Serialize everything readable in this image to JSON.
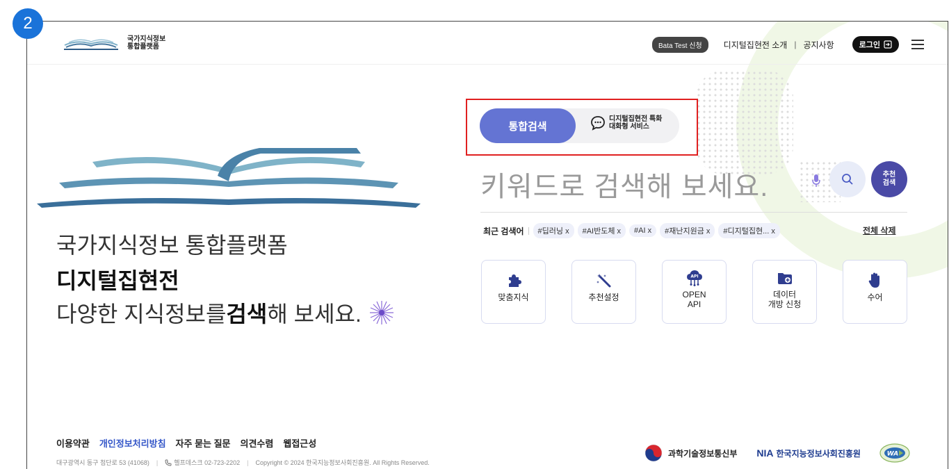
{
  "step_badge": "2",
  "header": {
    "logo_line1": "국가지식정보",
    "logo_line2": "통합플랫폼",
    "beta_button": "Bata Test 신청",
    "links": [
      "디지털집현전 소개",
      "공지사항"
    ],
    "separator": "|",
    "login_button": "로그인",
    "icons": [
      "logo-icon",
      "login-icon",
      "menu-icon"
    ]
  },
  "hero": {
    "line1": "국가지식정보 통합플랫폼",
    "line2": "디지털집현전",
    "line3_pre": "다양한 지식정보를 ",
    "line3_bold": "검색",
    "line3_post": "해 보세요."
  },
  "search": {
    "tab_active": "통합검색",
    "tab_chat_line1": "디지털집현전 특화",
    "tab_chat_line2": "대화형 서비스",
    "placeholder": "키워드로 검색해 보세요.",
    "recommend_line1": "추천",
    "recommend_line2": "검색",
    "recent_label": "최근 검색어",
    "recent_keywords": [
      "#딥러닝 x",
      "#AI반도체 x",
      "#AI x",
      "#재난지원금 x",
      "#디지털집현... x"
    ],
    "clear_all": "전체 삭제"
  },
  "quick_menu": [
    {
      "label": "맞춤지식",
      "icon": "puzzle-icon"
    },
    {
      "label": "추천설정",
      "icon": "magic-wand-icon"
    },
    {
      "label": "OPEN\nAPI",
      "icon": "api-cloud-icon"
    },
    {
      "label": "데이터\n개방 신청",
      "icon": "folder-icon"
    },
    {
      "label": "수어",
      "icon": "hand-icon"
    }
  ],
  "footer": {
    "links": [
      "이용약관",
      "개인정보처리방침",
      "자주 묻는 질문",
      "의견수렴",
      "웹접근성"
    ],
    "address": "대구광역시 동구 첨단로 53 (41068)",
    "helpdesk": "헬프데스크 02-723-2202",
    "copyright": "Copyright © 2024 한국지능정보사회진흥원. All Rights Reserved.",
    "ministry": "과학기술정보통신부",
    "nia_mark": "NIA",
    "nia_name": "한국지능정보사회진흥원",
    "wa_mark": "WA"
  },
  "colors": {
    "accent": "#6474d3",
    "recommend": "#4a4aa6",
    "highlight_box": "#e02020",
    "step_badge": "#1a73d9"
  }
}
